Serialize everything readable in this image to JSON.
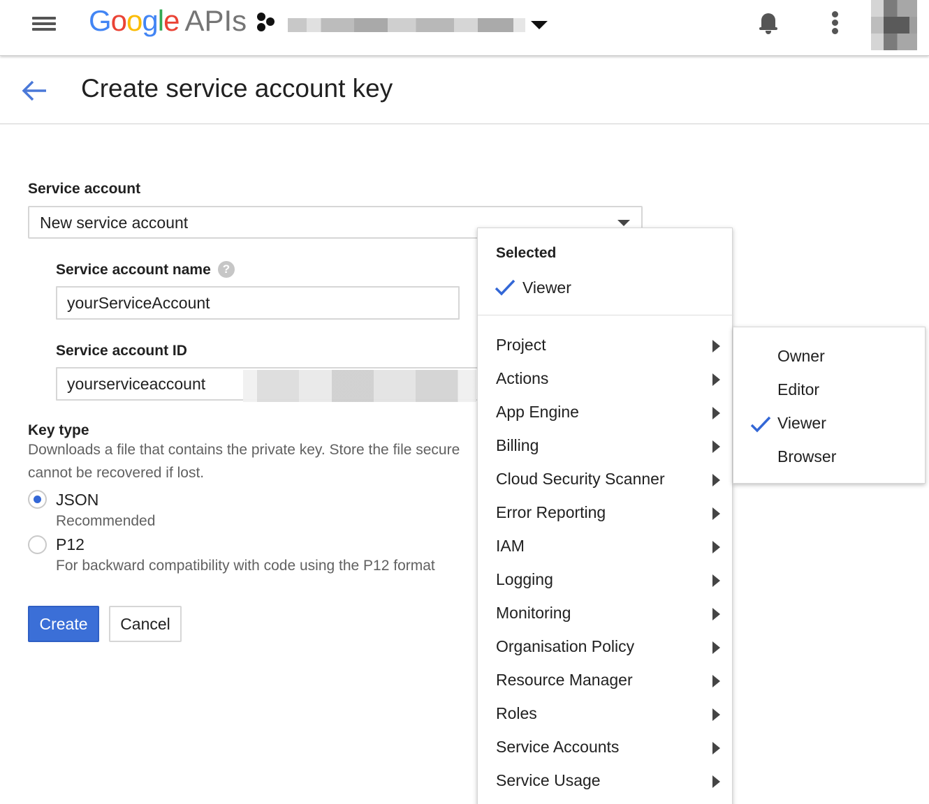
{
  "header": {
    "logo_google": [
      "G",
      "o",
      "o",
      "g",
      "l",
      "e"
    ],
    "logo_apis": "APIs",
    "menu_icon": "hamburger-menu-icon",
    "notifications_icon": "bell-icon",
    "more_icon": "kebab-menu-icon"
  },
  "page": {
    "title": "Create service account key",
    "back_icon": "arrow-back-icon"
  },
  "form": {
    "service_account_label": "Service account",
    "service_account_value": "New service account",
    "name_label": "Service account name",
    "name_value": "yourServiceAccount",
    "id_label": "Service account ID",
    "id_value": "yourserviceaccount",
    "key_type_label": "Key type",
    "key_type_desc_line1": "Downloads a file that contains the private key. Store the file secure",
    "key_type_desc_line2": "cannot be recovered if lost.",
    "options": [
      {
        "label": "JSON",
        "sub": "Recommended",
        "checked": true
      },
      {
        "label": "P12",
        "sub": "For backward compatibility with code using the P12 format",
        "checked": false
      }
    ],
    "create_label": "Create",
    "cancel_label": "Cancel"
  },
  "role_menu": {
    "selected_heading": "Selected",
    "selected_items": [
      "Viewer"
    ],
    "categories": [
      "Project",
      "Actions",
      "App Engine",
      "Billing",
      "Cloud Security Scanner",
      "Error Reporting",
      "IAM",
      "Logging",
      "Monitoring",
      "Organisation Policy",
      "Resource Manager",
      "Roles",
      "Service Accounts",
      "Service Usage"
    ]
  },
  "project_submenu": {
    "items": [
      {
        "label": "Owner",
        "checked": false
      },
      {
        "label": "Editor",
        "checked": false
      },
      {
        "label": "Viewer",
        "checked": true
      },
      {
        "label": "Browser",
        "checked": false
      }
    ]
  },
  "colors": {
    "accent": "#3b6fd7",
    "check": "#3367d6",
    "text": "#212121",
    "secondary_text": "#616161"
  }
}
